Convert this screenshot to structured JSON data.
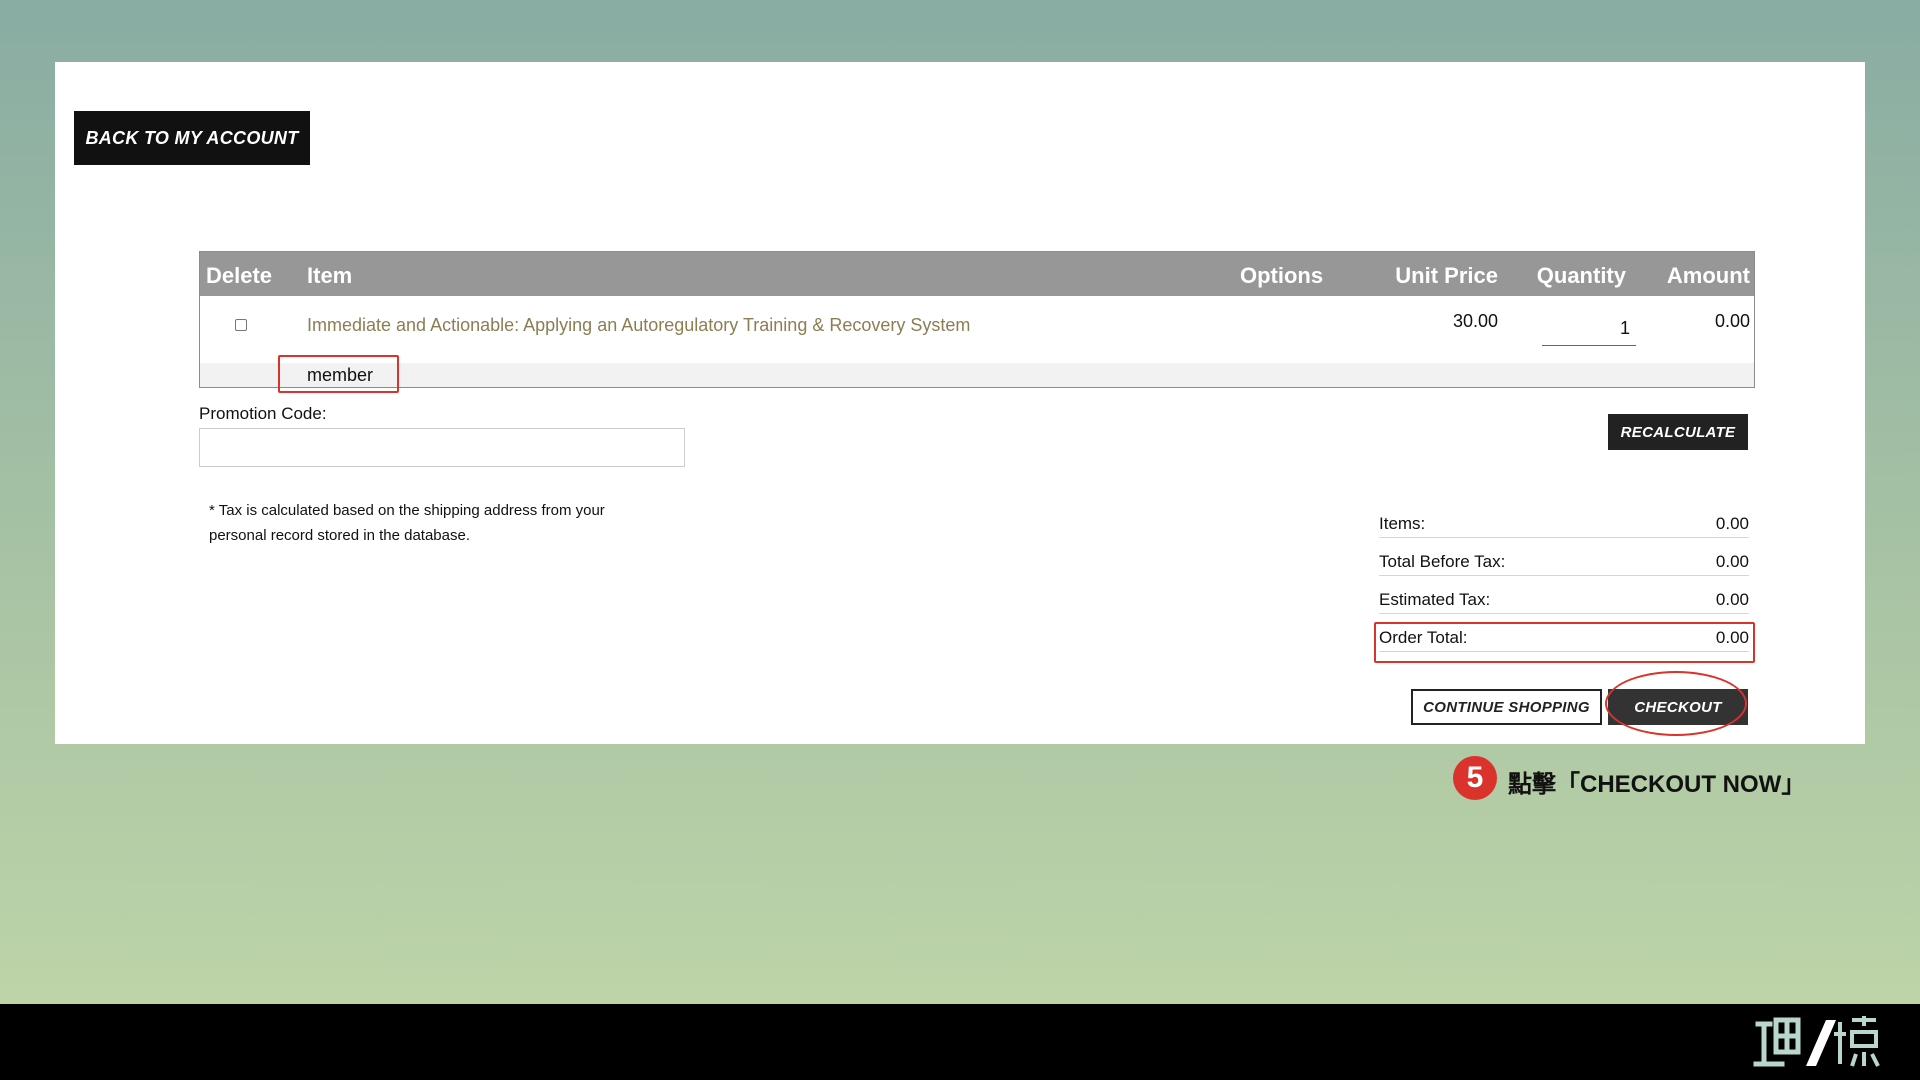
{
  "page": {
    "back_button": "BACK TO MY ACCOUNT"
  },
  "cart": {
    "headers": {
      "delete": "Delete",
      "item": "Item",
      "options": "Options",
      "unit_price": "Unit Price",
      "quantity": "Quantity",
      "amount": "Amount"
    },
    "rows": [
      {
        "item": "Immediate and Actionable: Applying an Autoregulatory Training & Recovery System",
        "option": "member",
        "unit_price": "30.00",
        "quantity": "1",
        "amount": "0.00",
        "checked": false
      }
    ]
  },
  "promotion": {
    "label": "Promotion Code:",
    "value": "",
    "placeholder": ""
  },
  "buttons": {
    "recalculate": "RECALCULATE",
    "continue_shopping": "CONTINUE SHOPPING",
    "checkout": "CHECKOUT"
  },
  "tax_note": "* Tax is calculated based on the shipping address from your personal record stored in the database.",
  "totals": [
    {
      "label": "Items:",
      "value": "0.00"
    },
    {
      "label": "Total Before Tax:",
      "value": "0.00"
    },
    {
      "label": "Estimated Tax:",
      "value": "0.00"
    },
    {
      "label": "Order Total:",
      "value": "0.00"
    }
  ],
  "annotation": {
    "step_number": "5",
    "text": "點擊「CHECKOUT NOW」",
    "highlight_color": "#d9332b"
  },
  "logo": {
    "icon": "brand-logo-icon"
  }
}
